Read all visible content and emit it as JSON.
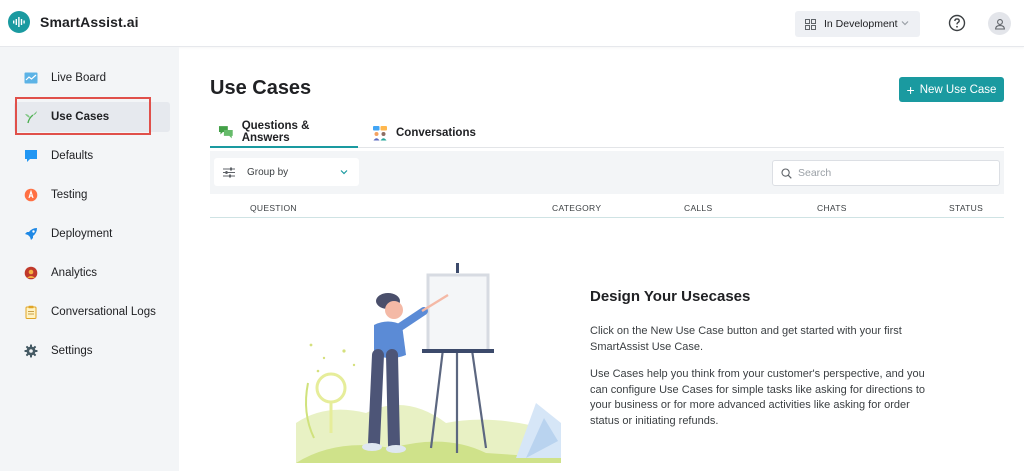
{
  "app": {
    "name": "SmartAssist.ai"
  },
  "header": {
    "environment": "In Development"
  },
  "sidebar": {
    "items": [
      {
        "label": "Live Board",
        "icon": "live-board-icon"
      },
      {
        "label": "Use Cases",
        "icon": "sprout-icon",
        "active": true
      },
      {
        "label": "Defaults",
        "icon": "chat-bubble-icon"
      },
      {
        "label": "Testing",
        "icon": "testing-icon"
      },
      {
        "label": "Deployment",
        "icon": "rocket-icon"
      },
      {
        "label": "Analytics",
        "icon": "analytics-icon"
      },
      {
        "label": "Conversational Logs",
        "icon": "clipboard-icon"
      },
      {
        "label": "Settings",
        "icon": "gear-icon"
      }
    ]
  },
  "main": {
    "title": "Use Cases",
    "new_button": "New Use Case",
    "tabs": [
      {
        "label": "Questions & Answers",
        "active": true
      },
      {
        "label": "Conversations",
        "active": false
      }
    ],
    "toolbar": {
      "group_by": "Group by",
      "search_placeholder": "Search"
    },
    "columns": [
      "QUESTION",
      "CATEGORY",
      "CALLS",
      "CHATS",
      "STATUS"
    ],
    "empty_state": {
      "title": "Design Your Usecases",
      "p1": "Click on the New Use Case button and get started with your first SmartAssist Use Case.",
      "p2": "Use Cases help you think from your customer's perspective, and you can configure Use Cases for simple tasks like asking for directions to your business or for more advanced activities like asking for order status or initiating refunds."
    }
  },
  "colors": {
    "accent": "#1a9aa0",
    "highlight": "#e0504a",
    "sidebar_bg": "#f3f5f7"
  }
}
